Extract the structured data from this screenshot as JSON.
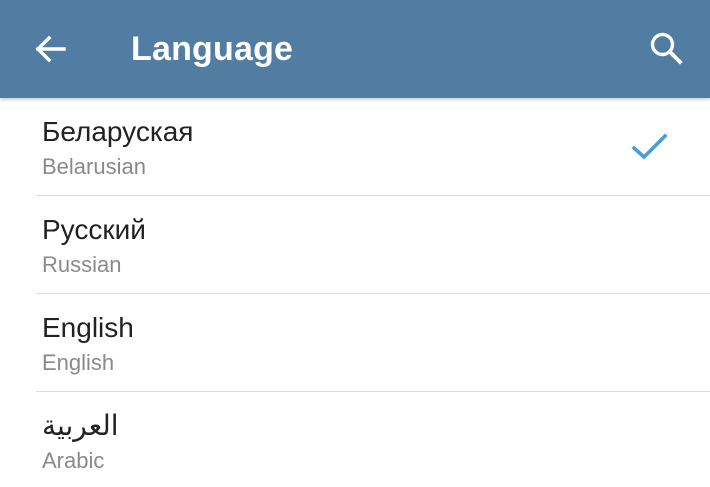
{
  "toolbar": {
    "title": "Language",
    "background_color": "#527da3",
    "back_icon": "arrow-left-icon",
    "search_icon": "search-icon"
  },
  "languages": [
    {
      "name": "Беларуская",
      "subtitle": "Belarusian",
      "selected": true
    },
    {
      "name": "Русский",
      "subtitle": "Russian",
      "selected": false
    },
    {
      "name": "English",
      "subtitle": "English",
      "selected": false
    },
    {
      "name": "العربية",
      "subtitle": "Arabic",
      "selected": false
    }
  ],
  "colors": {
    "check": "#4a9ed8",
    "name_text": "#222222",
    "subtitle_text": "#8a8a8a",
    "divider": "#dcdcdc"
  }
}
